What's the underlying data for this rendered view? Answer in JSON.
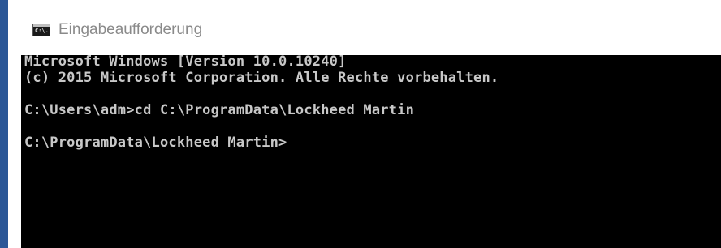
{
  "window": {
    "title": "Eingabeaufforderung",
    "icon": "command-prompt-icon",
    "icon_label": "C:\\."
  },
  "console": {
    "lines": [
      "Microsoft Windows [Version 10.0.10240]",
      "(c) 2015 Microsoft Corporation. Alle Rechte vorbehalten.",
      "C:\\Users\\adm>cd C:\\ProgramData\\Lockheed Martin",
      "C:\\ProgramData\\Lockheed Martin>"
    ],
    "colors": {
      "background": "#000000",
      "text": "#c8c8c8"
    }
  },
  "accent_color": "#2b5797"
}
